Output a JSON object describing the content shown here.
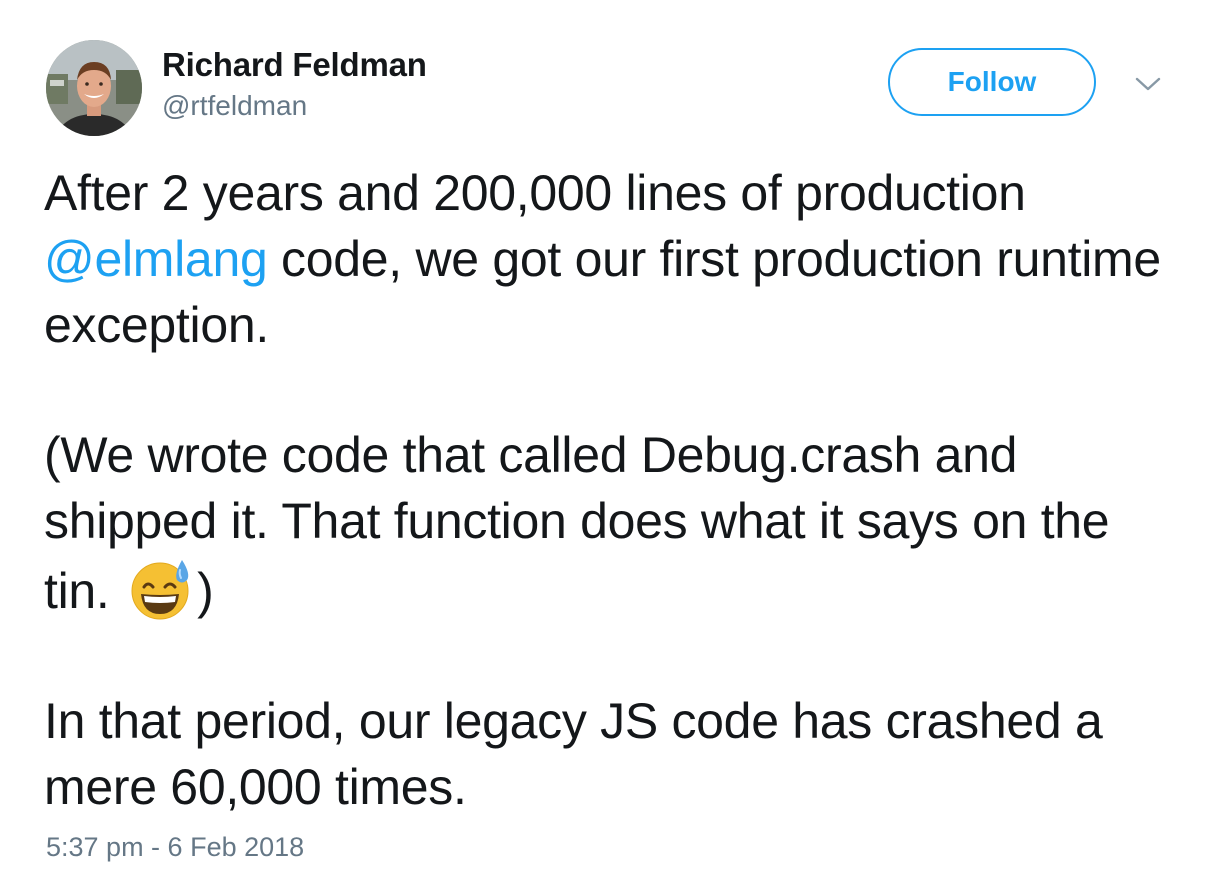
{
  "author": {
    "name": "Richard Feldman",
    "handle": "@rtfeldman"
  },
  "follow_button": {
    "label": "Follow"
  },
  "menu": {
    "icon": "chevron-down-icon"
  },
  "tweet": {
    "p1_part1": "After 2 years and 200,000 lines of production ",
    "p1_mention": "@elmlang",
    "p1_part2": " code, we got our first production runtime exception.",
    "p2_part1": "(We wrote code that called Debug.crash and shipped it. That function does what it says on the tin. ",
    "p2_emoji": "grinning-face-with-sweat-emoji",
    "p2_part2": ")",
    "p3": "In that period, our legacy JS code has crashed a mere 60,000 times."
  },
  "timestamp": "5:37 pm - 6 Feb 2018",
  "colors": {
    "accent": "#1da1f2",
    "text": "#14171a",
    "secondary": "#657786"
  }
}
